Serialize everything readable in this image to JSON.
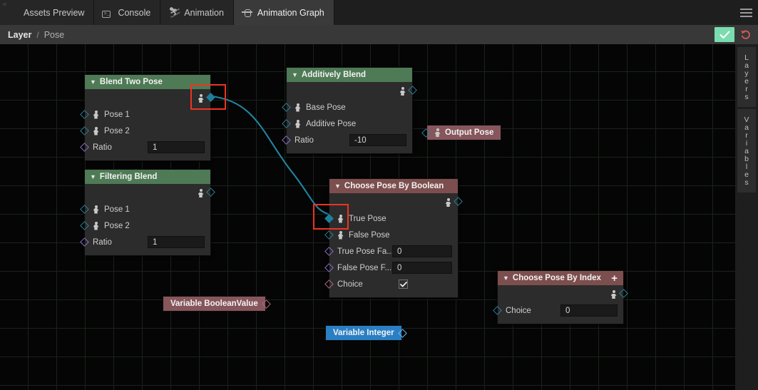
{
  "tabs": [
    {
      "label": "Assets Preview",
      "icon": "folder-icon",
      "active": false
    },
    {
      "label": "Console",
      "icon": "console-icon",
      "active": false
    },
    {
      "label": "Animation",
      "icon": "animation-icon",
      "active": false
    },
    {
      "label": "Animation Graph",
      "icon": "animation-graph-icon",
      "active": true
    }
  ],
  "breadcrumb": {
    "root": "Layer",
    "separator": "/",
    "current": "Pose"
  },
  "toolbar": {
    "apply_icon": "check-icon",
    "revert_icon": "undo-icon",
    "menu_icon": "hamburger-icon"
  },
  "dock": {
    "tabs": [
      "Layers",
      "Variables"
    ]
  },
  "nodes": [
    {
      "id": "blend-two-pose",
      "title": "Blend Two Pose",
      "header_color": "#4e7a55",
      "has_plus": false,
      "output": {
        "label": "",
        "selected": true
      },
      "rows": [
        {
          "label": "Pose 1",
          "pin": "teal",
          "pose_icon": true,
          "value": null
        },
        {
          "label": "Pose 2",
          "pin": "teal",
          "pose_icon": true,
          "value": null
        },
        {
          "label": "Ratio",
          "pin": "purple",
          "pose_icon": false,
          "value": "1"
        }
      ]
    },
    {
      "id": "filtering-blend",
      "title": "Filtering Blend",
      "header_color": "#4e7a55",
      "has_plus": false,
      "output": {
        "label": "",
        "selected": false
      },
      "rows": [
        {
          "label": "Pose 1",
          "pin": "teal",
          "pose_icon": true,
          "value": null
        },
        {
          "label": "Pose 2",
          "pin": "teal",
          "pose_icon": true,
          "value": null
        },
        {
          "label": "Ratio",
          "pin": "purple",
          "pose_icon": false,
          "value": "1"
        }
      ]
    },
    {
      "id": "additively-blend",
      "title": "Additively Blend",
      "header_color": "#4e7a55",
      "has_plus": false,
      "output": {
        "label": "",
        "selected": false
      },
      "rows": [
        {
          "label": "Base Pose",
          "pin": "teal",
          "pose_icon": true,
          "value": null
        },
        {
          "label": "Additive Pose",
          "pin": "teal",
          "pose_icon": true,
          "value": null
        },
        {
          "label": "Ratio",
          "pin": "purple",
          "pose_icon": false,
          "value": "-10"
        }
      ]
    },
    {
      "id": "choose-pose-by-boolean",
      "title": "Choose Pose By Boolean",
      "header_color": "#7d4e4e",
      "has_plus": false,
      "output": {
        "label": "",
        "selected": false
      },
      "rows": [
        {
          "label": "True Pose",
          "pin": "teal-filled",
          "pose_icon": true,
          "value": null
        },
        {
          "label": "False Pose",
          "pin": "teal",
          "pose_icon": true,
          "value": null
        },
        {
          "label": "True Pose Fa...",
          "pin": "purple",
          "pose_icon": false,
          "value": "0"
        },
        {
          "label": "False Pose F...",
          "pin": "purple",
          "pose_icon": false,
          "value": "0"
        },
        {
          "label": "Choice",
          "pin": "pink",
          "pose_icon": false,
          "value": "checked"
        }
      ]
    },
    {
      "id": "choose-pose-by-index",
      "title": "Choose Pose By Index",
      "header_color": "#7d4e4e",
      "has_plus": true,
      "plus_label": "+",
      "output": {
        "label": "",
        "selected": false
      },
      "rows": [
        {
          "label": "Choice",
          "pin": "teal",
          "pose_icon": false,
          "value": "0"
        }
      ]
    }
  ],
  "pills": [
    {
      "id": "output-pose",
      "label": "Output Pose",
      "style": "red",
      "pose_icon": true,
      "pin_side": "left"
    },
    {
      "id": "variable-boolean",
      "label": "Variable BooleanValue",
      "style": "red",
      "pose_icon": false,
      "pin_side": "right"
    },
    {
      "id": "variable-integer",
      "label": "Variable Integer",
      "style": "blue",
      "pose_icon": false,
      "pin_side": "right"
    }
  ],
  "selection": {
    "color": "#ef3322",
    "count": 2
  },
  "connection": {
    "color": "#2184a0",
    "from": "blend-two-pose.output",
    "to": "choose-pose-by-boolean.True Pose"
  }
}
